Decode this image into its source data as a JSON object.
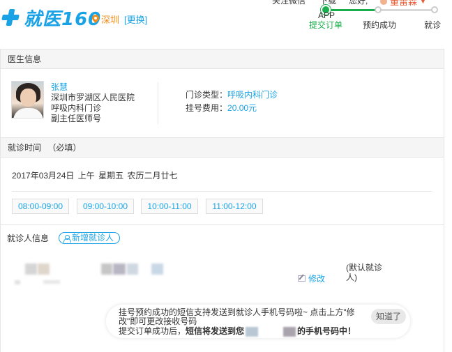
{
  "header": {
    "logo_text": "就医160",
    "city": "深圳",
    "city_change": "[更换]",
    "top_links": [
      "关注微信",
      "下载",
      "您好,"
    ],
    "user_name": "董雷霖"
  },
  "progress": {
    "steps": [
      {
        "label_top": "APP",
        "label": "提交订单",
        "active": true
      },
      {
        "label": "预约成功",
        "active": false
      },
      {
        "label": "就诊",
        "active": false
      }
    ],
    "colors": {
      "active": "#1aad4b",
      "inactive": "#333333"
    }
  },
  "doctor_section": {
    "title": "医生信息",
    "name": "张慧",
    "hospital": "深圳市罗湖区人民医院",
    "department": "呼吸内科门诊",
    "title_rank": "副主任医师号",
    "clinic_type_label": "门诊类型：",
    "clinic_type_value": "呼吸内科门诊",
    "fee_label": "挂号费用：",
    "fee_value": "20.00元"
  },
  "time_section": {
    "title": "就诊时间",
    "required": "（必填）",
    "date": "2017年03月24日",
    "period": "上午",
    "weekday": "星期五",
    "lunar": "农历二月廿七",
    "slots": [
      "08:00-09:00",
      "09:00-10:00",
      "10:00-11:00",
      "11:00-12:00"
    ]
  },
  "patient_section": {
    "title": "就诊人信息",
    "add_button": "新增就诊人",
    "edit": "修改",
    "default_tag": "(默认就诊人)"
  },
  "tip": {
    "line1": "挂号预约成功的短信支持发送到就诊人手机号码啦~ 点击上方\"修改\"即可更改接收号码",
    "line2_prefix": "提交订单成功后，",
    "line2_bold": "短信将发送到您",
    "line2_suffix": "的手机号码中！",
    "ok_button": "知道了"
  },
  "accent_color": "#19a3e6"
}
